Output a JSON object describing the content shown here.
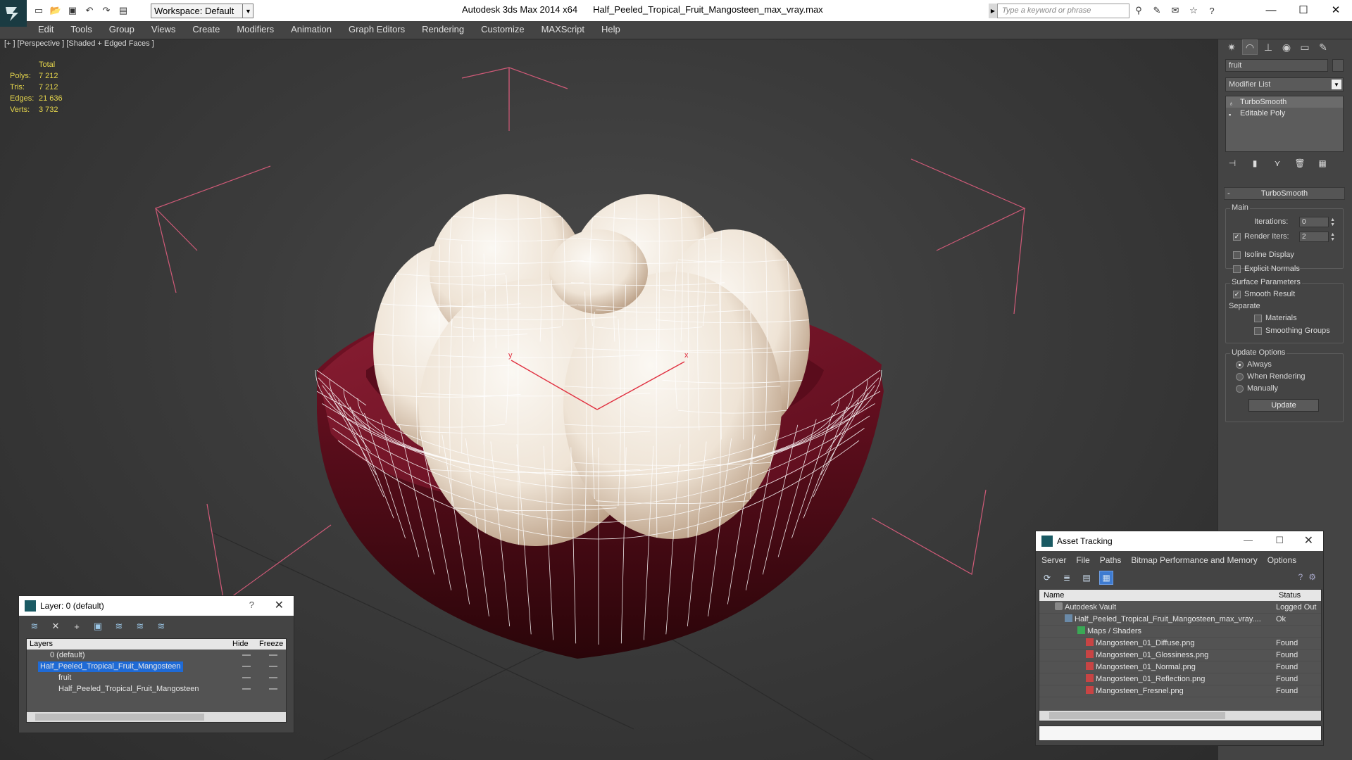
{
  "titlebar": {
    "workspace": "Workspace: Default",
    "app": "Autodesk 3ds Max  2014 x64",
    "file": "Half_Peeled_Tropical_Fruit_Mangosteen_max_vray.max",
    "search_placeholder": "Type a keyword or phrase"
  },
  "menu": [
    "Edit",
    "Tools",
    "Group",
    "Views",
    "Create",
    "Modifiers",
    "Animation",
    "Graph Editors",
    "Rendering",
    "Customize",
    "MAXScript",
    "Help"
  ],
  "viewport": {
    "label": "[+ ] [Perspective ] [Shaded + Edged Faces ]",
    "stats": {
      "total_label": "Total",
      "rows": [
        {
          "k": "Polys:",
          "v": "7 212"
        },
        {
          "k": "Tris:",
          "v": "7 212"
        },
        {
          "k": "Edges:",
          "v": "21 636"
        },
        {
          "k": "Verts:",
          "v": "3 732"
        }
      ]
    },
    "axis_x": "x",
    "axis_y": "y",
    "colors": {
      "rind": "#6b0f22",
      "flesh": "#efe6dc",
      "wire": "#ffffff",
      "bracket": "#d05a78"
    }
  },
  "command_panel": {
    "object_name": "fruit",
    "modifier_list": "Modifier List",
    "stack": [
      "TurboSmooth",
      "Editable Poly"
    ],
    "rollout": "TurboSmooth",
    "main": "Main",
    "iterations_label": "Iterations:",
    "iterations": "0",
    "render_iters_label": "Render Iters:",
    "render_iters": "2",
    "isoline": "Isoline Display",
    "explicit_normals": "Explicit Normals",
    "surface_params": "Surface Parameters",
    "smooth_result": "Smooth Result",
    "separate": "Separate",
    "materials": "Materials",
    "smoothing_groups": "Smoothing Groups",
    "update_options": "Update Options",
    "always": "Always",
    "when_rendering": "When Rendering",
    "manually": "Manually",
    "update": "Update"
  },
  "layer_dialog": {
    "title": "Layer: 0 (default)",
    "help": "?",
    "col_layers": "Layers",
    "col_hide": "Hide",
    "col_freeze": "Freeze",
    "rows": [
      {
        "name": "0 (default)"
      },
      {
        "name": "Half_Peeled_Tropical_Fruit_Mangosteen"
      },
      {
        "name": "fruit"
      },
      {
        "name": "Half_Peeled_Tropical_Fruit_Mangosteen"
      }
    ]
  },
  "asset_dialog": {
    "title": "Asset Tracking",
    "menu": [
      "Server",
      "File",
      "Paths",
      "Bitmap Performance and Memory",
      "Options"
    ],
    "col_name": "Name",
    "col_status": "Status",
    "rows": [
      {
        "name": "Autodesk Vault",
        "status": "Logged Out"
      },
      {
        "name": "Half_Peeled_Tropical_Fruit_Mangosteen_max_vray....",
        "status": "Ok"
      },
      {
        "name": "Maps / Shaders",
        "status": ""
      },
      {
        "name": "Mangosteen_01_Diffuse.png",
        "status": "Found"
      },
      {
        "name": "Mangosteen_01_Glossiness.png",
        "status": "Found"
      },
      {
        "name": "Mangosteen_01_Normal.png",
        "status": "Found"
      },
      {
        "name": "Mangosteen_01_Reflection.png",
        "status": "Found"
      },
      {
        "name": "Mangosteen_Fresnel.png",
        "status": "Found"
      }
    ]
  }
}
